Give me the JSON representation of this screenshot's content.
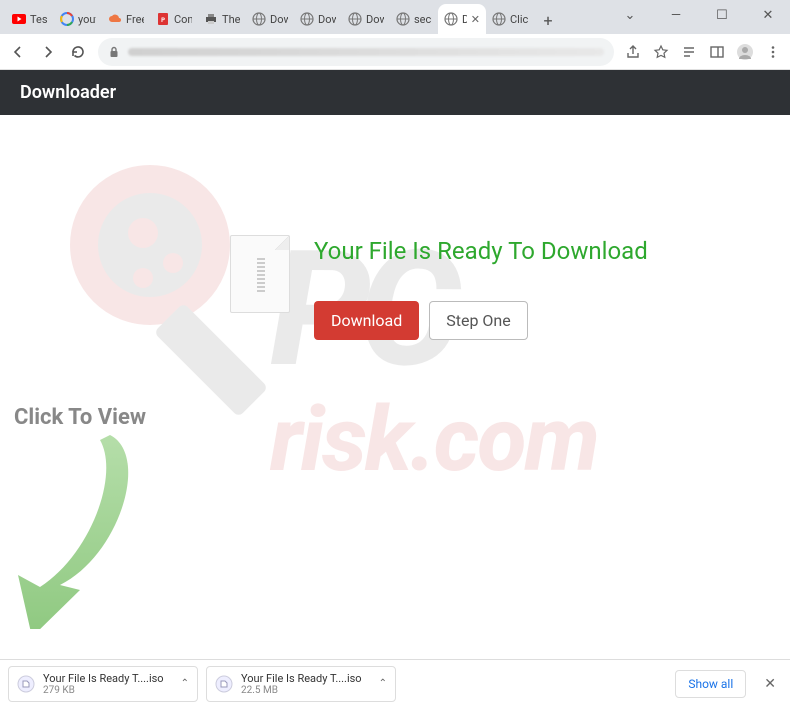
{
  "window": {
    "minimize": "—",
    "maximize": "☐",
    "close": "✕",
    "dropdown": "⌄"
  },
  "tabs": [
    {
      "label": "Tesl",
      "favicon": "youtube"
    },
    {
      "label": "yout",
      "favicon": "google"
    },
    {
      "label": "Free",
      "favicon": "cloud"
    },
    {
      "label": "Con",
      "favicon": "pdf"
    },
    {
      "label": "The",
      "favicon": "printer"
    },
    {
      "label": "Dow",
      "favicon": "globe"
    },
    {
      "label": "Dow",
      "favicon": "globe"
    },
    {
      "label": "Dow",
      "favicon": "globe"
    },
    {
      "label": "secu",
      "favicon": "globe"
    },
    {
      "label": "D",
      "favicon": "globe",
      "active": true
    },
    {
      "label": "Click",
      "favicon": "globe"
    }
  ],
  "new_tab": "+",
  "address": {
    "lock": "🔒"
  },
  "page": {
    "header": "Downloader",
    "title": "Your File Is Ready To Download",
    "download_btn": "Download",
    "step_btn": "Step One",
    "ctv": "Click To View"
  },
  "shelf": {
    "items": [
      {
        "name": "Your File Is Ready T....iso",
        "size": "279 KB"
      },
      {
        "name": "Your File Is Ready T....iso",
        "size": "22.5 MB"
      }
    ],
    "show_all": "Show all",
    "chevron": "⌃"
  }
}
